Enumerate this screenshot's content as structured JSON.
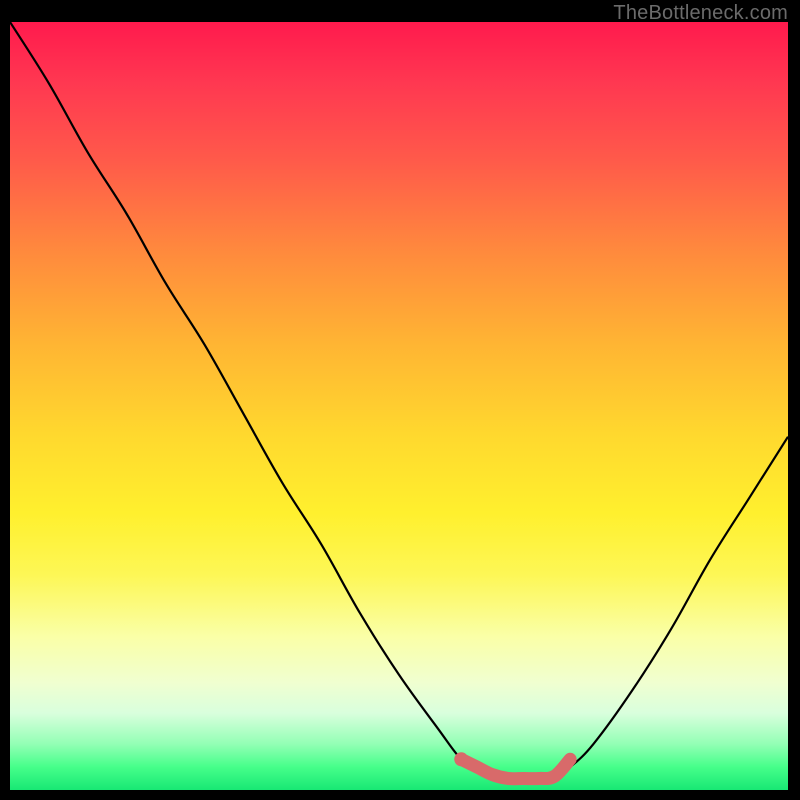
{
  "watermark": "TheBottleneck.com",
  "colors": {
    "gradient_top": "#ff1a4d",
    "gradient_bottom": "#18e874",
    "curve": "#000000",
    "marker": "#d86a6a",
    "background": "#000000"
  },
  "chart_data": {
    "type": "line",
    "title": "",
    "xlabel": "",
    "ylabel": "",
    "xlim": [
      0,
      100
    ],
    "ylim": [
      0,
      100
    ],
    "series": [
      {
        "name": "bottleneck-curve",
        "x": [
          0,
          5,
          10,
          15,
          20,
          25,
          30,
          35,
          40,
          45,
          50,
          55,
          58,
          60,
          62,
          64,
          66,
          68,
          70,
          72,
          75,
          80,
          85,
          90,
          95,
          100
        ],
        "y": [
          100,
          92,
          83,
          75,
          66,
          58,
          49,
          40,
          32,
          23,
          15,
          8,
          4,
          3,
          2,
          1.5,
          1.5,
          1.5,
          1.8,
          3,
          6,
          13,
          21,
          30,
          38,
          46
        ]
      }
    ],
    "markers": {
      "name": "optimal-band",
      "x": [
        58,
        60,
        62,
        64,
        66,
        68,
        70,
        72
      ],
      "y": [
        4,
        3,
        2,
        1.5,
        1.5,
        1.5,
        1.8,
        4
      ]
    }
  }
}
